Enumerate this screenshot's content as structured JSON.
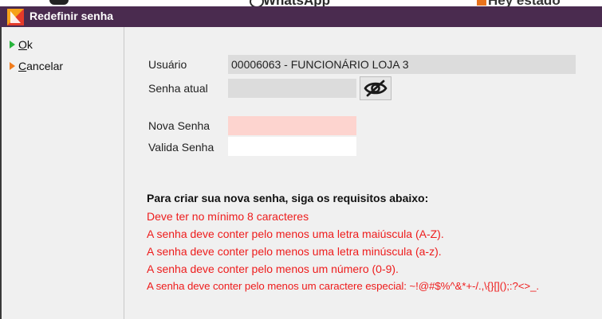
{
  "background": {
    "middle_text": "WhatsApp",
    "right_text": "Hey estado"
  },
  "window": {
    "title": "Redefinir senha"
  },
  "sidebar": {
    "ok": {
      "accel": "O",
      "rest": "k"
    },
    "cancel": {
      "accel": "C",
      "rest": "ancelar"
    }
  },
  "form": {
    "usuario": {
      "label": "Usuário",
      "value": "00006063 - FUNCIONÁRIO LOJA 3"
    },
    "senha_atual": {
      "label": "Senha atual",
      "value": ""
    },
    "nova_senha": {
      "label": "Nova Senha",
      "value": ""
    },
    "valida_senha": {
      "label": "Valida Senha",
      "value": ""
    },
    "toggle_icon": "eye-slash-icon"
  },
  "requirements": {
    "title": "Para criar sua nova senha, siga os requisitos abaixo:",
    "items": [
      "Deve ter no mínimo 8 caracteres",
      "A senha deve conter pelo menos uma letra maiúscula (A-Z).",
      "A senha deve conter pelo menos uma letra minúscula (a-z).",
      "A senha deve conter pelo menos um número (0-9).",
      "A senha deve conter pelo menos um caractere especial: ~!@#$%^&*+-/.,\\{}[]();:?<>_."
    ]
  },
  "colors": {
    "titlebar": "#4a2b4f",
    "requirement_text": "#ee1c1c",
    "nova_senha_bg": "#fdd4cf",
    "ok_marker": "#28b43c",
    "cancel_marker": "#f07c1c"
  }
}
